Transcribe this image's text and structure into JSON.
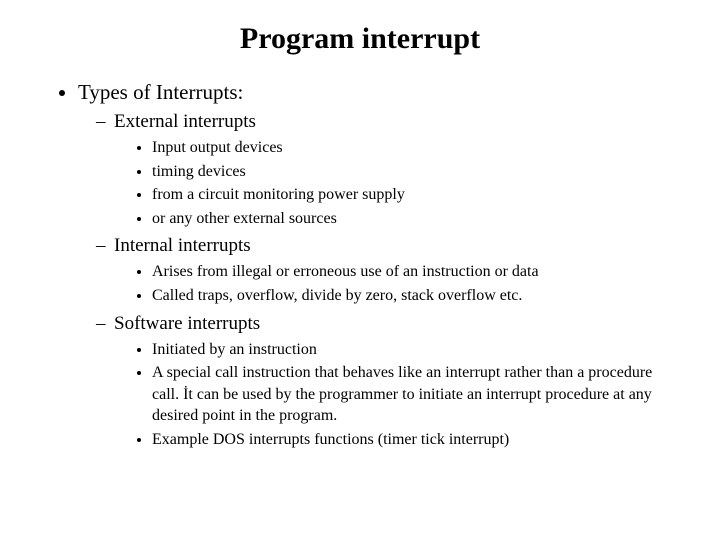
{
  "title": "Program interrupt",
  "l1": {
    "item0": "Types of Interrupts:"
  },
  "l2": {
    "external": {
      "label": "External interrupts",
      "items": {
        "i0": "Input output devices",
        "i1": "timing devices",
        "i2": "from a circuit monitoring power supply",
        "i3": "or any other external sources"
      }
    },
    "internal": {
      "label": "Internal interrupts",
      "items": {
        "i0": "Arises from illegal or erroneous use of an instruction or data",
        "i1": "Called traps, overflow, divide by zero, stack overflow etc."
      }
    },
    "software": {
      "label": "Software interrupts",
      "items": {
        "i0": "Initiated by an instruction",
        "i1": "A special call instruction that behaves like an interrupt rather than a procedure call. İt can be used by the programmer to initiate an interrupt procedure at any desired point in the program.",
        "i2": "Example DOS interrupts functions (timer tick interrupt)"
      }
    }
  }
}
